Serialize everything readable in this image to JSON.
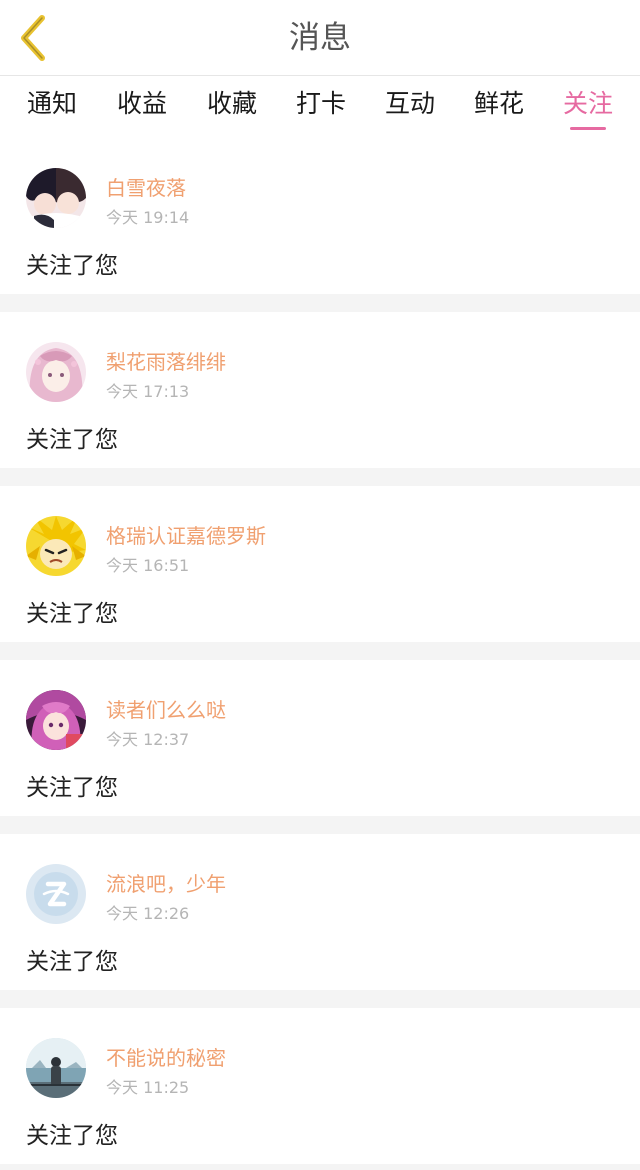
{
  "header": {
    "title": "消息",
    "back_icon": "chevron-left-icon"
  },
  "colors": {
    "accent": "#e66aa1",
    "username": "#f0a070",
    "back_icon": "#e8c230"
  },
  "tabs": [
    {
      "label": "通知",
      "active": false
    },
    {
      "label": "收益",
      "active": false
    },
    {
      "label": "收藏",
      "active": false
    },
    {
      "label": "打卡",
      "active": false
    },
    {
      "label": "互动",
      "active": false
    },
    {
      "label": "鲜花",
      "active": false
    },
    {
      "label": "关注",
      "active": true
    }
  ],
  "notifications": [
    {
      "username": "白雪夜落",
      "time": "今天 19:14",
      "action": "关注了您",
      "avatar": "avatar-couple"
    },
    {
      "username": "梨花雨落绯绯",
      "time": "今天 17:13",
      "action": "关注了您",
      "avatar": "avatar-pink-hair-girl"
    },
    {
      "username": "格瑞认证嘉德罗斯",
      "time": "今天 16:51",
      "action": "关注了您",
      "avatar": "avatar-yellow-character"
    },
    {
      "username": "读者们么么哒",
      "time": "今天 12:37",
      "action": "关注了您",
      "avatar": "avatar-purple-hair-girl"
    },
    {
      "username": "流浪吧，少年",
      "time": "今天 12:26",
      "action": "关注了您",
      "avatar": "avatar-default-qq"
    },
    {
      "username": "不能说的秘密",
      "time": "今天 11:25",
      "action": "关注了您",
      "avatar": "avatar-seaside-person"
    }
  ]
}
